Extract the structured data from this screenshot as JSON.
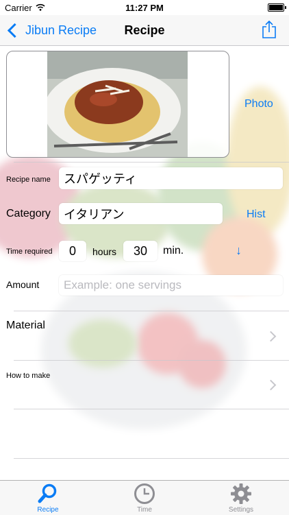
{
  "status_bar": {
    "carrier": "Carrier",
    "time": "11:27 PM"
  },
  "nav": {
    "back_label": "Jibun Recipe",
    "title": "Recipe"
  },
  "photo": {
    "link_label": "Photo"
  },
  "form": {
    "recipe_name": {
      "label": "Recipe name",
      "value": "スパゲッティ"
    },
    "category": {
      "label": "Category",
      "value": "イタリアン",
      "history_label": "Hist"
    },
    "time_required": {
      "label": "Time required",
      "hours_value": "0",
      "hours_unit": "hours",
      "minutes_value": "30",
      "minutes_unit": "min.",
      "arrow": "↓"
    },
    "amount": {
      "label": "Amount",
      "placeholder": "Example: one servings"
    }
  },
  "sections": {
    "material_label": "Material",
    "how_to_make_label": "How to make"
  },
  "tabs": [
    {
      "label": "Recipe",
      "active": true
    },
    {
      "label": "Time",
      "active": false
    },
    {
      "label": "Settings",
      "active": false
    }
  ],
  "colors": {
    "accent": "#0a7cf5",
    "tab_inactive": "#8e8e93"
  }
}
